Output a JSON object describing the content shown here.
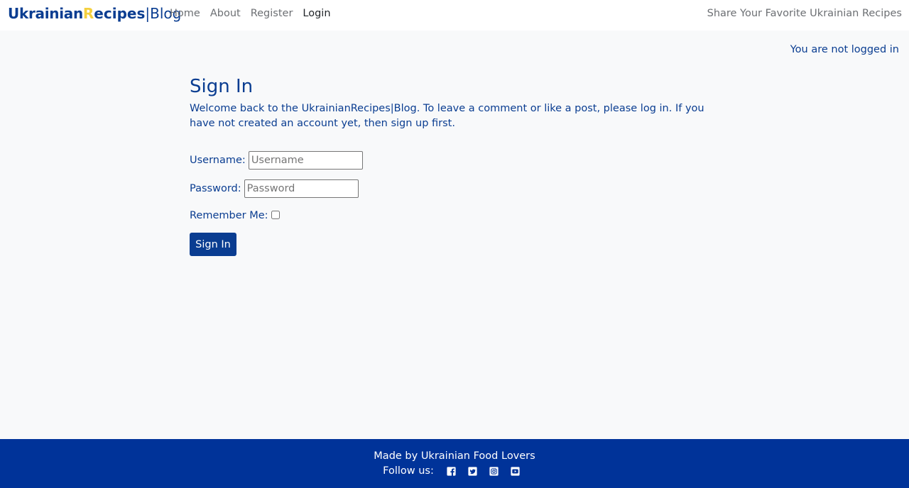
{
  "nav": {
    "brand": {
      "part1": "Ukrainian",
      "part2": "R",
      "part3": "ecipes",
      "separator": "|",
      "part4": "Blog"
    },
    "links": [
      {
        "label": "Home"
      },
      {
        "label": "About"
      },
      {
        "label": "Register"
      },
      {
        "label": "Login"
      }
    ],
    "tagline": "Share Your Favorite Ukrainian Recipes"
  },
  "status": {
    "text": "You are not logged in"
  },
  "signin": {
    "title": "Sign In",
    "intro": "Welcome back to the UkrainianRecipes|Blog. To leave a comment or like a post, please log in. If you have not created an account yet, then sign up first.",
    "username_label": "Username:",
    "username_placeholder": "Username",
    "password_label": "Password:",
    "password_placeholder": "Password",
    "remember_label": "Remember Me:",
    "submit_label": "Sign In"
  },
  "footer": {
    "made_by": "Made by Ukrainian Food Lovers",
    "follow_label": "Follow us:",
    "social": [
      {
        "icon": "facebook-icon"
      },
      {
        "icon": "twitter-icon"
      },
      {
        "icon": "instagram-icon"
      },
      {
        "icon": "youtube-icon"
      }
    ]
  },
  "colors": {
    "primary": "#0a3d91",
    "accent_yellow": "#f4d03f",
    "footer_bg": "#003399",
    "page_bg": "#f8f9fa"
  }
}
